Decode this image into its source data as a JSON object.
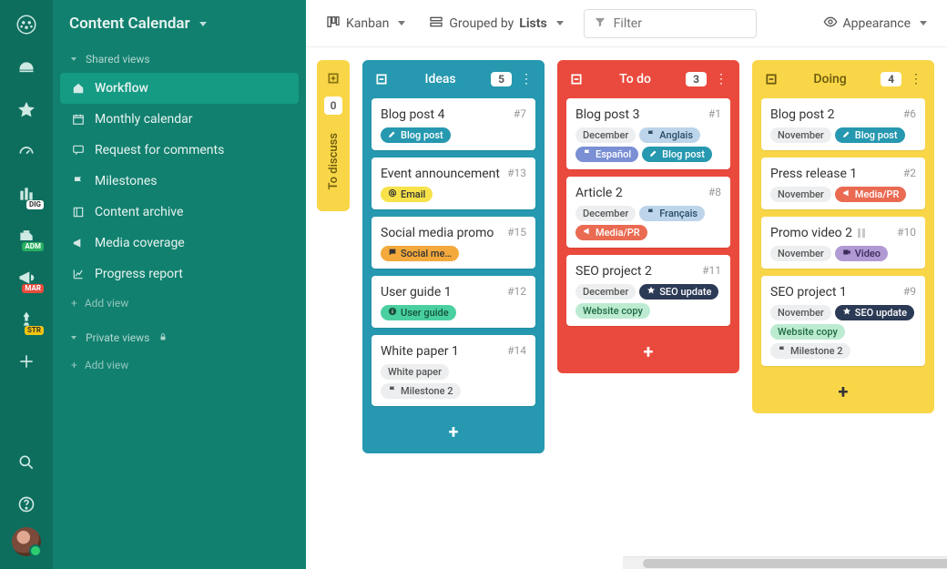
{
  "header": {
    "title": "Content Calendar"
  },
  "sidebar": {
    "shared_label": "Shared views",
    "private_label": "Private views",
    "add_view": "Add view",
    "items": [
      {
        "label": "Workflow",
        "icon": "home"
      },
      {
        "label": "Monthly calendar",
        "icon": "calendar"
      },
      {
        "label": "Request for comments",
        "icon": "chat"
      },
      {
        "label": "Milestones",
        "icon": "flag"
      },
      {
        "label": "Content archive",
        "icon": "archive"
      },
      {
        "label": "Media coverage",
        "icon": "bullhorn"
      },
      {
        "label": "Progress report",
        "icon": "chart"
      }
    ]
  },
  "toolbar": {
    "view_mode": "Kanban",
    "grouped_prefix": "Grouped by",
    "grouped_value": "Lists",
    "filter_placeholder": "Filter",
    "appearance": "Appearance"
  },
  "collapsed_column": {
    "title": "To discuss",
    "count": "0"
  },
  "columns": [
    {
      "title": "Ideas",
      "count": "5",
      "color": "teal",
      "cards": [
        {
          "title": "Blog post 4",
          "num": "#7",
          "tags": [
            {
              "label": "Blog post",
              "icon": "pencil",
              "bg": "#2698b0",
              "fg": "#fff"
            }
          ]
        },
        {
          "title": "Event announcement",
          "num": "#13",
          "tags": [
            {
              "label": "Email",
              "icon": "at",
              "bg": "#f7e24a",
              "fg": "#333"
            }
          ]
        },
        {
          "title": "Social media promo",
          "num": "#15",
          "tags": [
            {
              "label": "Social me…",
              "icon": "chat",
              "bg": "#f3a93c",
              "fg": "#333"
            }
          ]
        },
        {
          "title": "User guide 1",
          "num": "#12",
          "tags": [
            {
              "label": "User guide",
              "icon": "info",
              "bg": "#4ad0a0",
              "fg": "#14543c"
            }
          ]
        },
        {
          "title": "White paper 1",
          "num": "#14",
          "tags": [
            {
              "label": "White paper",
              "icon": "",
              "bg": "#eceeef",
              "fg": "#555"
            },
            {
              "label": "Milestone 2",
              "icon": "flag",
              "bg": "#eceeef",
              "fg": "#555"
            }
          ]
        }
      ]
    },
    {
      "title": "To do",
      "count": "3",
      "color": "red",
      "cards": [
        {
          "title": "Blog post 3",
          "num": "#1",
          "tags": [
            {
              "label": "December",
              "icon": "",
              "bg": "#eceeef",
              "fg": "#555"
            },
            {
              "label": "Anglais",
              "icon": "flag",
              "bg": "#bcd5ea",
              "fg": "#2a4a66"
            },
            {
              "label": "Español",
              "icon": "flag",
              "bg": "#7a8fd4",
              "fg": "#fff"
            },
            {
              "label": "Blog post",
              "icon": "pencil",
              "bg": "#2698b0",
              "fg": "#fff"
            }
          ]
        },
        {
          "title": "Article 2",
          "num": "#8",
          "tags": [
            {
              "label": "December",
              "icon": "",
              "bg": "#eceeef",
              "fg": "#555"
            },
            {
              "label": "Français",
              "icon": "flag",
              "bg": "#bcd5ea",
              "fg": "#2a4a66"
            },
            {
              "label": "Media/PR",
              "icon": "bullhorn",
              "bg": "#ea6a52",
              "fg": "#fff"
            }
          ]
        },
        {
          "title": "SEO project 2",
          "num": "#11",
          "tags": [
            {
              "label": "December",
              "icon": "",
              "bg": "#eceeef",
              "fg": "#555"
            },
            {
              "label": "SEO update",
              "icon": "star",
              "bg": "#2b3a55",
              "fg": "#fff"
            },
            {
              "label": "Website copy",
              "icon": "",
              "bg": "#bcebd2",
              "fg": "#1f6b44"
            }
          ]
        }
      ]
    },
    {
      "title": "Doing",
      "count": "4",
      "color": "yellow",
      "cards": [
        {
          "title": "Blog post 2",
          "num": "#6",
          "tags": [
            {
              "label": "November",
              "icon": "",
              "bg": "#eceeef",
              "fg": "#555"
            },
            {
              "label": "Blog post",
              "icon": "pencil",
              "bg": "#2698b0",
              "fg": "#fff"
            }
          ]
        },
        {
          "title": "Press release 1",
          "num": "#2",
          "tags": [
            {
              "label": "November",
              "icon": "",
              "bg": "#eceeef",
              "fg": "#555"
            },
            {
              "label": "Media/PR",
              "icon": "bullhorn",
              "bg": "#ea6a52",
              "fg": "#fff"
            }
          ]
        },
        {
          "title": "Promo video 2",
          "num": "#10",
          "paused": true,
          "tags": [
            {
              "label": "November",
              "icon": "",
              "bg": "#eceeef",
              "fg": "#555"
            },
            {
              "label": "Video",
              "icon": "video",
              "bg": "#b19ad4",
              "fg": "#3a2a5a"
            }
          ]
        },
        {
          "title": "SEO project 1",
          "num": "#9",
          "tags": [
            {
              "label": "November",
              "icon": "",
              "bg": "#eceeef",
              "fg": "#555"
            },
            {
              "label": "SEO update",
              "icon": "star",
              "bg": "#2b3a55",
              "fg": "#fff"
            },
            {
              "label": "Website copy",
              "icon": "",
              "bg": "#bcebd2",
              "fg": "#1f6b44"
            },
            {
              "label": "Milestone 2",
              "icon": "flag",
              "bg": "#eceeef",
              "fg": "#555"
            }
          ]
        }
      ]
    }
  ],
  "iconbar_badges": {
    "dig": "DIG",
    "adm": "ADM",
    "mar": "MAR",
    "str": "STR"
  }
}
